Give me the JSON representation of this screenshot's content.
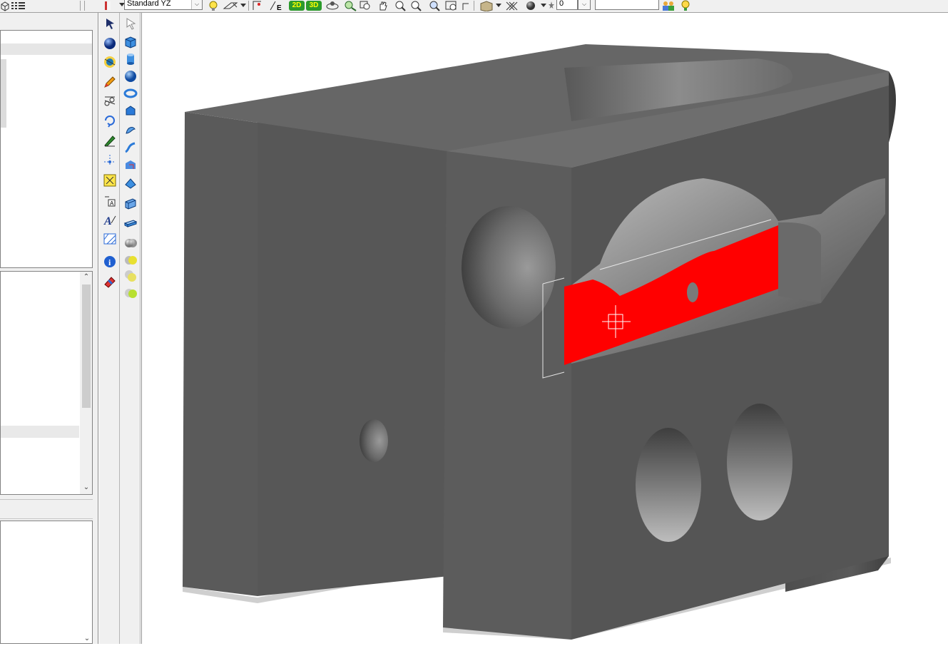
{
  "toolbar": {
    "view_select": "Standard YZ",
    "view_2d_label": "2D",
    "view_3d_label": "3D",
    "layer_value": "0",
    "name_field_value": ""
  },
  "viewport": {
    "part_color": "#5a5a5a",
    "selected_face_color": "#ff0000"
  },
  "palette": {
    "left_tools": [
      "select-arrow-icon",
      "sphere-icon",
      "rotate-view-icon",
      "pencil-sketch-icon",
      "trim-icon",
      "transform-icon",
      "draw-line-icon",
      "axis-icon",
      "dimension-icon",
      "text-leader-icon",
      "text-edit-icon",
      "hatch-icon",
      "info-icon",
      "eraser-icon"
    ],
    "right_tools": [
      "pointer-icon",
      "box-solid-icon",
      "cylinder-icon",
      "sphere-solid-icon",
      "torus-icon",
      "cone-icon",
      "sweep-icon",
      "loft-icon",
      "revolve-icon",
      "extrude-icon",
      "shell-icon",
      "fillet-icon",
      "chamfer-icon",
      "boolean-union-icon",
      "boolean-subtract-icon",
      "boolean-intersect-icon",
      "material-icon"
    ]
  }
}
